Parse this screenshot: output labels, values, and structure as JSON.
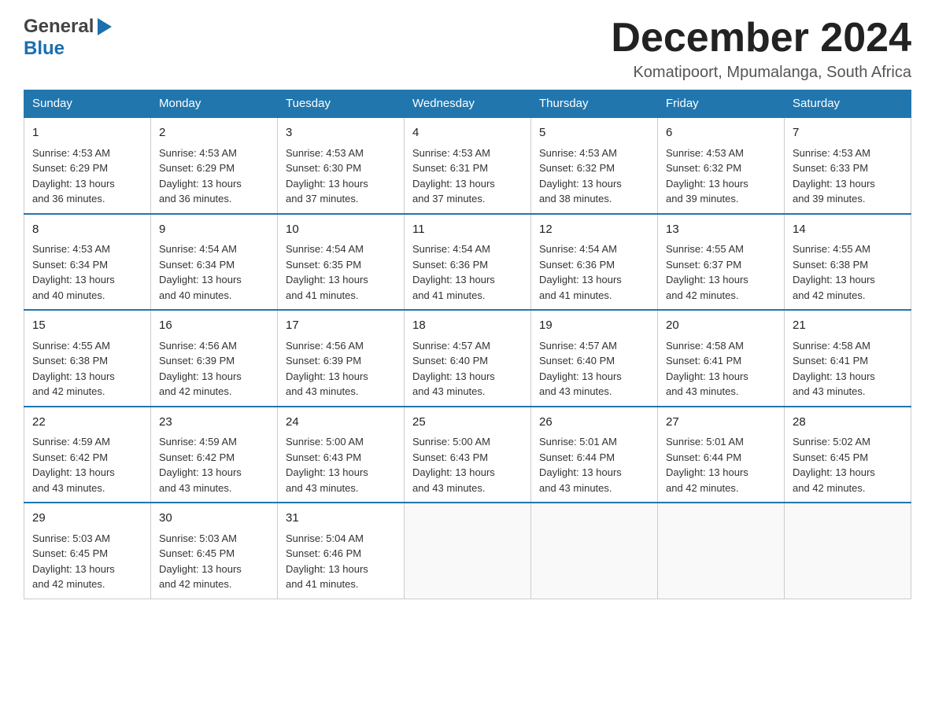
{
  "header": {
    "month_title": "December 2024",
    "location": "Komatipoort, Mpumalanga, South Africa",
    "logo_general": "General",
    "logo_blue": "Blue"
  },
  "days_of_week": [
    "Sunday",
    "Monday",
    "Tuesday",
    "Wednesday",
    "Thursday",
    "Friday",
    "Saturday"
  ],
  "weeks": [
    [
      {
        "day": "1",
        "sunrise": "4:53 AM",
        "sunset": "6:29 PM",
        "daylight": "13 hours and 36 minutes."
      },
      {
        "day": "2",
        "sunrise": "4:53 AM",
        "sunset": "6:29 PM",
        "daylight": "13 hours and 36 minutes."
      },
      {
        "day": "3",
        "sunrise": "4:53 AM",
        "sunset": "6:30 PM",
        "daylight": "13 hours and 37 minutes."
      },
      {
        "day": "4",
        "sunrise": "4:53 AM",
        "sunset": "6:31 PM",
        "daylight": "13 hours and 37 minutes."
      },
      {
        "day": "5",
        "sunrise": "4:53 AM",
        "sunset": "6:32 PM",
        "daylight": "13 hours and 38 minutes."
      },
      {
        "day": "6",
        "sunrise": "4:53 AM",
        "sunset": "6:32 PM",
        "daylight": "13 hours and 39 minutes."
      },
      {
        "day": "7",
        "sunrise": "4:53 AM",
        "sunset": "6:33 PM",
        "daylight": "13 hours and 39 minutes."
      }
    ],
    [
      {
        "day": "8",
        "sunrise": "4:53 AM",
        "sunset": "6:34 PM",
        "daylight": "13 hours and 40 minutes."
      },
      {
        "day": "9",
        "sunrise": "4:54 AM",
        "sunset": "6:34 PM",
        "daylight": "13 hours and 40 minutes."
      },
      {
        "day": "10",
        "sunrise": "4:54 AM",
        "sunset": "6:35 PM",
        "daylight": "13 hours and 41 minutes."
      },
      {
        "day": "11",
        "sunrise": "4:54 AM",
        "sunset": "6:36 PM",
        "daylight": "13 hours and 41 minutes."
      },
      {
        "day": "12",
        "sunrise": "4:54 AM",
        "sunset": "6:36 PM",
        "daylight": "13 hours and 41 minutes."
      },
      {
        "day": "13",
        "sunrise": "4:55 AM",
        "sunset": "6:37 PM",
        "daylight": "13 hours and 42 minutes."
      },
      {
        "day": "14",
        "sunrise": "4:55 AM",
        "sunset": "6:38 PM",
        "daylight": "13 hours and 42 minutes."
      }
    ],
    [
      {
        "day": "15",
        "sunrise": "4:55 AM",
        "sunset": "6:38 PM",
        "daylight": "13 hours and 42 minutes."
      },
      {
        "day": "16",
        "sunrise": "4:56 AM",
        "sunset": "6:39 PM",
        "daylight": "13 hours and 42 minutes."
      },
      {
        "day": "17",
        "sunrise": "4:56 AM",
        "sunset": "6:39 PM",
        "daylight": "13 hours and 43 minutes."
      },
      {
        "day": "18",
        "sunrise": "4:57 AM",
        "sunset": "6:40 PM",
        "daylight": "13 hours and 43 minutes."
      },
      {
        "day": "19",
        "sunrise": "4:57 AM",
        "sunset": "6:40 PM",
        "daylight": "13 hours and 43 minutes."
      },
      {
        "day": "20",
        "sunrise": "4:58 AM",
        "sunset": "6:41 PM",
        "daylight": "13 hours and 43 minutes."
      },
      {
        "day": "21",
        "sunrise": "4:58 AM",
        "sunset": "6:41 PM",
        "daylight": "13 hours and 43 minutes."
      }
    ],
    [
      {
        "day": "22",
        "sunrise": "4:59 AM",
        "sunset": "6:42 PM",
        "daylight": "13 hours and 43 minutes."
      },
      {
        "day": "23",
        "sunrise": "4:59 AM",
        "sunset": "6:42 PM",
        "daylight": "13 hours and 43 minutes."
      },
      {
        "day": "24",
        "sunrise": "5:00 AM",
        "sunset": "6:43 PM",
        "daylight": "13 hours and 43 minutes."
      },
      {
        "day": "25",
        "sunrise": "5:00 AM",
        "sunset": "6:43 PM",
        "daylight": "13 hours and 43 minutes."
      },
      {
        "day": "26",
        "sunrise": "5:01 AM",
        "sunset": "6:44 PM",
        "daylight": "13 hours and 43 minutes."
      },
      {
        "day": "27",
        "sunrise": "5:01 AM",
        "sunset": "6:44 PM",
        "daylight": "13 hours and 42 minutes."
      },
      {
        "day": "28",
        "sunrise": "5:02 AM",
        "sunset": "6:45 PM",
        "daylight": "13 hours and 42 minutes."
      }
    ],
    [
      {
        "day": "29",
        "sunrise": "5:03 AM",
        "sunset": "6:45 PM",
        "daylight": "13 hours and 42 minutes."
      },
      {
        "day": "30",
        "sunrise": "5:03 AM",
        "sunset": "6:45 PM",
        "daylight": "13 hours and 42 minutes."
      },
      {
        "day": "31",
        "sunrise": "5:04 AM",
        "sunset": "6:46 PM",
        "daylight": "13 hours and 41 minutes."
      },
      null,
      null,
      null,
      null
    ]
  ],
  "labels": {
    "sunrise": "Sunrise:",
    "sunset": "Sunset:",
    "daylight": "Daylight:"
  }
}
